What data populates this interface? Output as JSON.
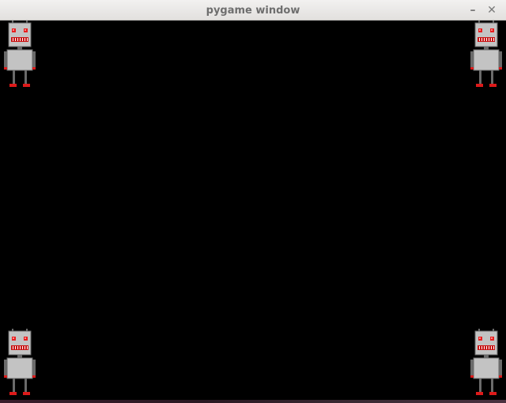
{
  "window": {
    "title": "pygame window",
    "minimize_glyph": "–",
    "close_glyph": "✕"
  },
  "game": {
    "background": "#000000",
    "robot_colors": {
      "body": "#c3c3c3",
      "eyes": "#e81e1e",
      "mouth": "#c81414",
      "feet": "#dd1a1a",
      "outline": "#6a6a6a"
    },
    "sprites": [
      {
        "name": "robot",
        "corner": "top-left"
      },
      {
        "name": "robot",
        "corner": "top-right"
      },
      {
        "name": "robot",
        "corner": "bottom-left"
      },
      {
        "name": "robot",
        "corner": "bottom-right"
      }
    ]
  }
}
